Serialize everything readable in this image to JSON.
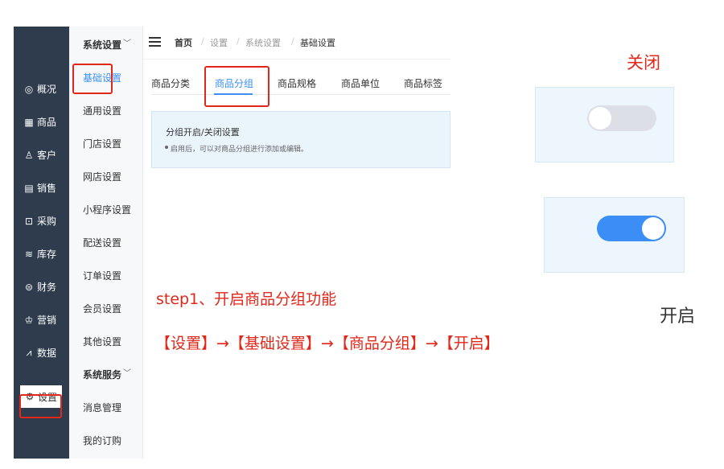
{
  "sidebar": {
    "items": [
      {
        "icon": "dashboard-icon",
        "glyph": "◎",
        "label": "概况"
      },
      {
        "icon": "grid-icon",
        "glyph": "▦",
        "label": "商品"
      },
      {
        "icon": "user-icon",
        "glyph": "♙",
        "label": "客户"
      },
      {
        "icon": "clipboard-icon",
        "glyph": "▤",
        "label": "销售"
      },
      {
        "icon": "cart-icon",
        "glyph": "⊡",
        "label": "采购"
      },
      {
        "icon": "layers-icon",
        "glyph": "≋",
        "label": "库存"
      },
      {
        "icon": "currency-icon",
        "glyph": "⊜",
        "label": "财务"
      },
      {
        "icon": "crown-icon",
        "glyph": "♔",
        "label": "营销"
      },
      {
        "icon": "chart-icon",
        "glyph": "⩘",
        "label": "数据"
      },
      {
        "icon": "gear-icon",
        "glyph": "⚙",
        "label": "设置"
      }
    ]
  },
  "subnav": {
    "group1": "系统设置",
    "items": [
      "基础设置",
      "通用设置",
      "门店设置",
      "网店设置",
      "小程序设置",
      "配送设置",
      "订单设置",
      "会员设置",
      "其他设置"
    ],
    "group2": "系统服务",
    "items2": [
      "消息管理",
      "我的订购"
    ]
  },
  "header": {
    "breadcrumb": [
      "首页",
      "设置",
      "系统设置",
      "基础设置"
    ],
    "sep": "/"
  },
  "tabs": [
    "商品分类",
    "商品分组",
    "商品规格",
    "商品单位",
    "商品标签"
  ],
  "notice": {
    "title": "分组开启/关闭设置",
    "desc": "启用后，可以对商品分组进行添加或编辑。"
  },
  "annotations": {
    "off_label": "关闭",
    "on_label": "开启",
    "step": "step1、开启商品分组功能",
    "path": "【设置】→【基础设置】→【商品分组】→【开启】"
  },
  "toggles": {
    "off": false,
    "on": true
  },
  "colors": {
    "accent": "#3a8ef6",
    "sidebar": "#2f3c4e",
    "highlight": "#e0271a"
  }
}
